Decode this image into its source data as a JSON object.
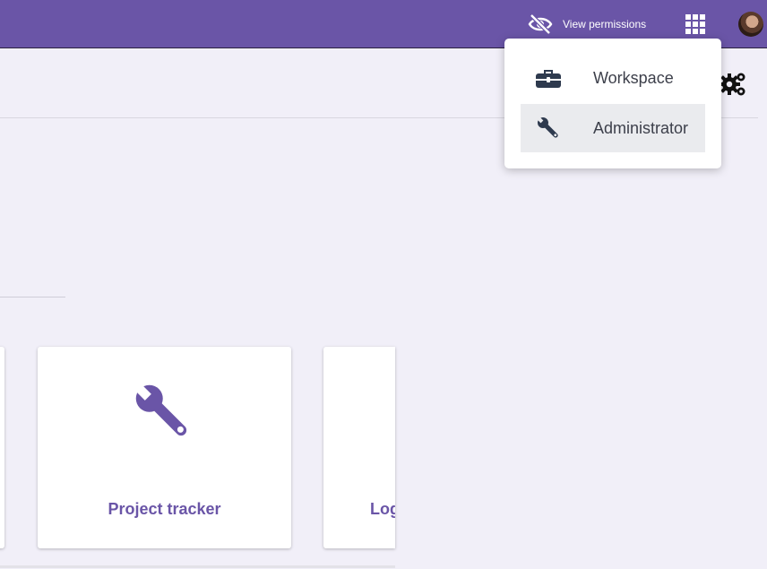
{
  "topbar": {
    "view_permissions_label": "View permissions",
    "apps_icon": "grid-icon",
    "avatar_icon": "user-avatar",
    "accent": "#6a55a7"
  },
  "dropdown": {
    "items": [
      {
        "label": "Workspace",
        "icon": "briefcase-icon",
        "active": false
      },
      {
        "label": "Administrator",
        "icon": "wrench-icon",
        "active": true
      }
    ]
  },
  "toolbar": {
    "settings_icon": "gears-icon"
  },
  "cards": [
    {
      "title": "Project tracker",
      "icon": "wrench-icon"
    },
    {
      "title": "Log",
      "icon": ""
    }
  ]
}
